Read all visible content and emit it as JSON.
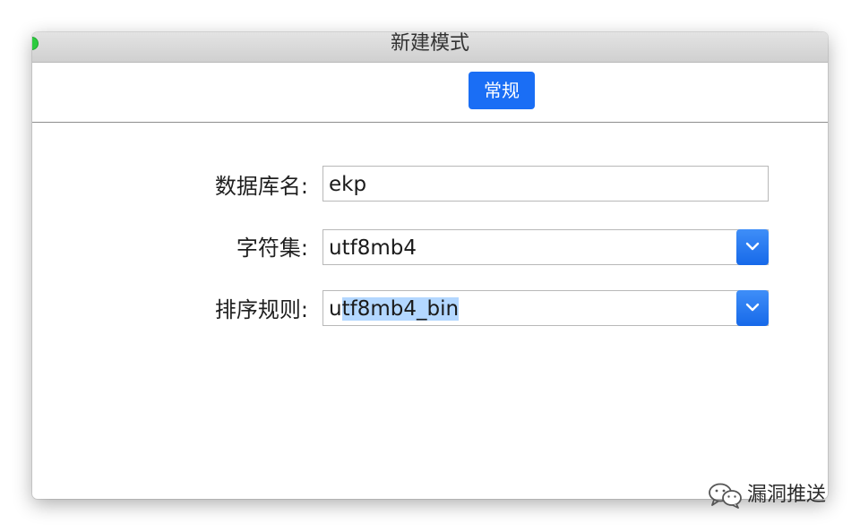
{
  "window": {
    "title": "新建模式"
  },
  "tabs": [
    {
      "label": "常规",
      "active": true
    }
  ],
  "form": {
    "database_name": {
      "label": "数据库名:",
      "value": "ekp"
    },
    "charset": {
      "label": "字符集:",
      "value": "utf8mb4"
    },
    "collation": {
      "label": "排序规则:",
      "value_prefix": "u",
      "value_selected": "tf8mb4_bin"
    }
  },
  "watermark": {
    "text": "漏洞推送",
    "icon": "wechat-icon"
  },
  "colors": {
    "accent": "#1a6ef5",
    "selection": "#b3d7ff"
  }
}
